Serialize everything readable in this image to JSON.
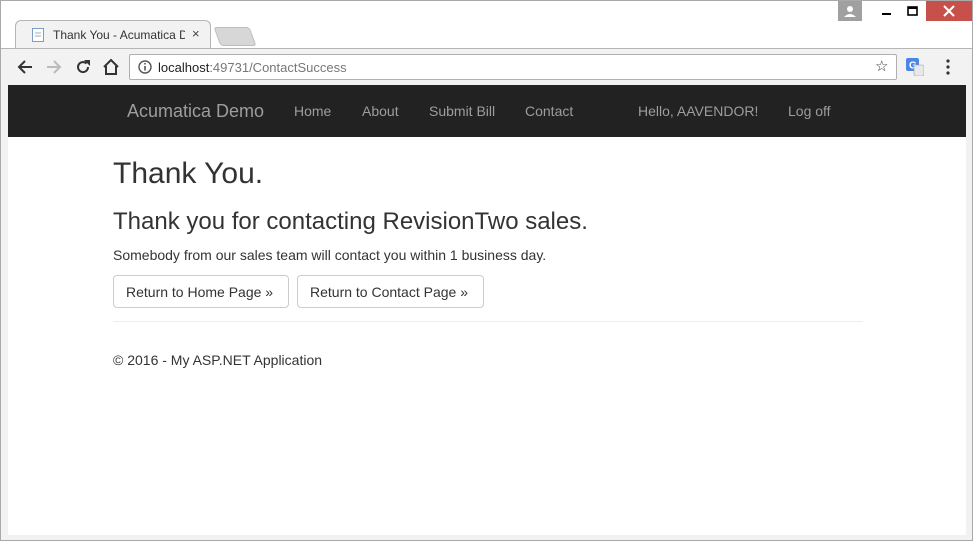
{
  "browser": {
    "tab_title": "Thank You - Acumatica D",
    "tab_close": "×",
    "url_host": "localhost",
    "url_path": ":49731/ContactSuccess",
    "star": "☆"
  },
  "navbar": {
    "brand": "Acumatica Demo",
    "links": [
      "Home",
      "About",
      "Submit Bill",
      "Contact"
    ],
    "greeting": "Hello, AAVENDOR!",
    "logoff": "Log off"
  },
  "main": {
    "title": "Thank You.",
    "subtitle": "Thank you for contacting RevisionTwo sales.",
    "message": "Somebody from our sales team will contact you within 1 business day.",
    "buttons": [
      "Return to Home Page »",
      "Return to Contact Page »"
    ]
  },
  "footer": {
    "text": "© 2016 - My ASP.NET Application"
  },
  "colors": {
    "navbar_bg": "#222222",
    "nav_text": "#9d9d9d",
    "close_btn": "#c7504a"
  }
}
